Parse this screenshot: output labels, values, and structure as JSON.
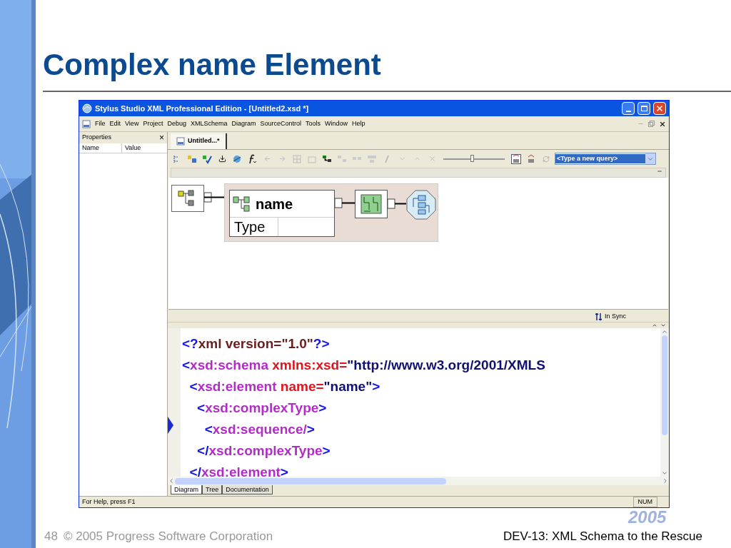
{
  "slide": {
    "title": "Complex name Element",
    "page_number": "48",
    "copyright": "© 2005 Progress Software Corporation",
    "talk_title": "DEV-13: XML Schema to the Rescue",
    "logo_year": "2005"
  },
  "window": {
    "title": "Stylus Studio XML Professional Edition - [Untitled2.xsd *]",
    "menu": [
      "File",
      "Edit",
      "View",
      "Project",
      "Debug",
      "XMLSchema",
      "Diagram",
      "SourceControl",
      "Tools",
      "Window",
      "Help"
    ],
    "properties": {
      "title": "Properties",
      "close": "×",
      "columns": [
        "Name",
        "Value"
      ]
    },
    "document_tab": {
      "label": "Untitled...*",
      "selected": true
    },
    "toolbar": {
      "zoom": {
        "level": 0.47
      },
      "query": {
        "value": "<Type a new query>",
        "selected": true
      }
    },
    "diagram": {
      "element": {
        "name": "name",
        "type_label": "Type"
      }
    },
    "sync": {
      "label": "In Sync"
    },
    "code": [
      {
        "tokens": [
          {
            "kind": "bracket",
            "text": "<?"
          },
          {
            "kind": "pi",
            "text": "xml version=\"1.0\""
          },
          {
            "kind": "bracket",
            "text": "?>"
          }
        ]
      },
      {
        "tokens": [
          {
            "kind": "bracket",
            "text": "<"
          },
          {
            "kind": "tag",
            "text": "xsd:schema"
          },
          {
            "kind": "attr",
            "text": " xmlns:xsd="
          },
          {
            "kind": "value",
            "text": "\"http://www.w3.org/2001/XMLS"
          }
        ]
      },
      {
        "tokens": [
          {
            "kind": "bracket",
            "text": "  <"
          },
          {
            "kind": "tag",
            "text": "xsd:element"
          },
          {
            "kind": "attr",
            "text": " name="
          },
          {
            "kind": "value",
            "text": "\"name\""
          },
          {
            "kind": "bracket",
            "text": ">"
          }
        ]
      },
      {
        "tokens": [
          {
            "kind": "bracket",
            "text": "    <"
          },
          {
            "kind": "tag",
            "text": "xsd:complexType"
          },
          {
            "kind": "bracket",
            "text": ">"
          }
        ]
      },
      {
        "tokens": [
          {
            "kind": "bracket",
            "text": "      <"
          },
          {
            "kind": "tag",
            "text": "xsd:sequence/"
          },
          {
            "kind": "bracket",
            "text": ">"
          }
        ],
        "current": true
      },
      {
        "tokens": [
          {
            "kind": "bracket",
            "text": "    </"
          },
          {
            "kind": "tag",
            "text": "xsd:complexType"
          },
          {
            "kind": "bracket",
            "text": ">"
          }
        ]
      },
      {
        "tokens": [
          {
            "kind": "bracket",
            "text": "  </"
          },
          {
            "kind": "tag",
            "text": "xsd:element"
          },
          {
            "kind": "bracket",
            "text": ">"
          }
        ]
      }
    ],
    "view_tabs": [
      {
        "label": "Diagram",
        "selected": true
      },
      {
        "label": "Tree",
        "selected": false
      },
      {
        "label": "Documentation",
        "selected": false
      }
    ],
    "status_bar": {
      "message": "For Help, press F1",
      "num": "NUM"
    }
  }
}
